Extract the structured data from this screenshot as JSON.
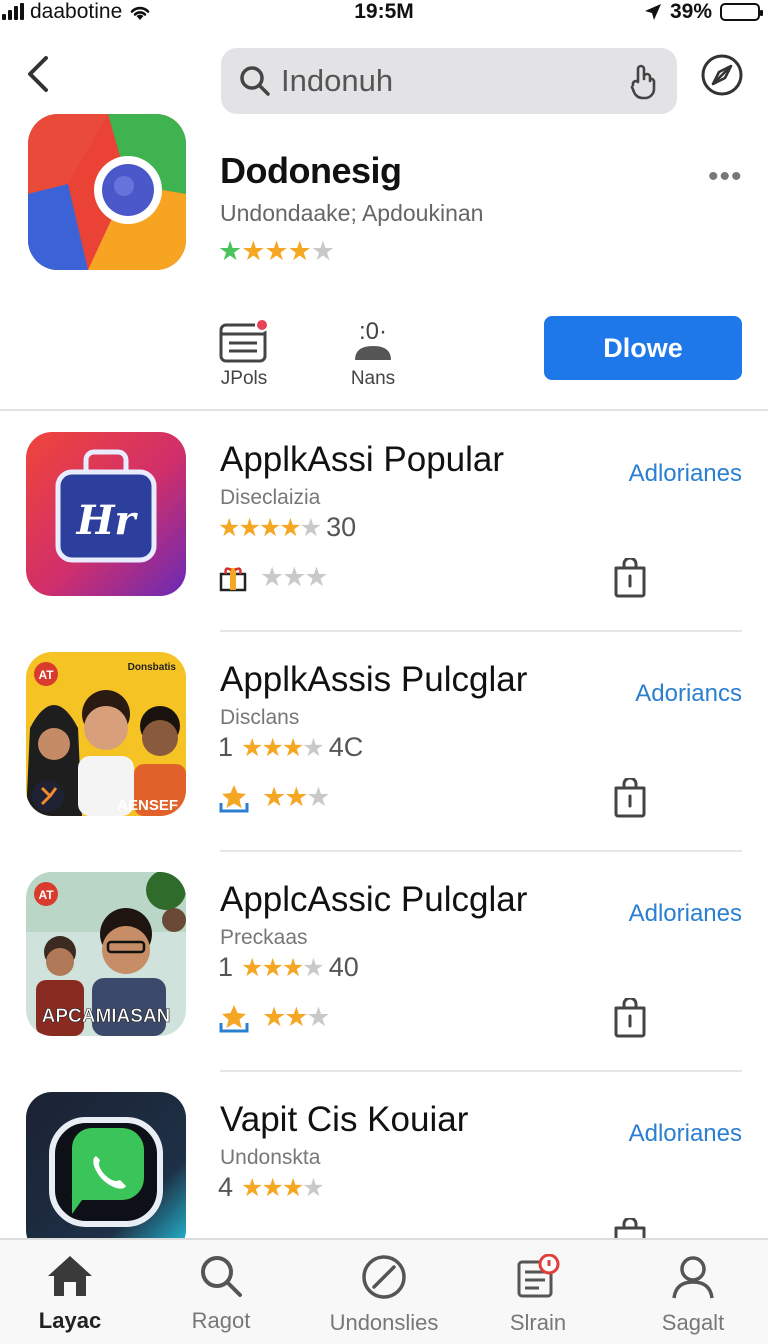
{
  "status_bar": {
    "carrier": "daabotine",
    "time": "19:5M",
    "battery": "39%"
  },
  "search": {
    "value": "Indonuh"
  },
  "hero": {
    "title": "Dodonesig",
    "subtitle": "Undondaake; Apdoukinan",
    "stars": "★★★★★",
    "more": "•••",
    "actions": [
      {
        "label": "JPols"
      },
      {
        "label": "Nans",
        "glyph": ":0·"
      }
    ],
    "get_label": "Dlowe"
  },
  "apps": [
    {
      "title": "ApplkAssi Popular",
      "subtitle": "Diseclaizia",
      "rating_prefix": "",
      "rating_suffix": "30",
      "action": "Adlorianes"
    },
    {
      "title": "ApplkAssis Pulcglar",
      "subtitle": "Disclans",
      "rating_prefix": "1",
      "rating_suffix": "4C",
      "action": "Adoriancs",
      "icon_text": "AENSEF",
      "icon_badge": "AT",
      "icon_corner": "Donsbatis"
    },
    {
      "title": "ApplcAssic Pulcglar",
      "subtitle": "Preckaas",
      "rating_prefix": "1",
      "rating_suffix": "40",
      "action": "Adlorianes",
      "icon_text": "APCAMIASAN",
      "icon_badge": "AT"
    },
    {
      "title": "Vapit Cis Kouiar",
      "subtitle": "Undonsktа",
      "rating_prefix": "4",
      "rating_suffix": "",
      "action": "Adlorianes"
    }
  ],
  "tabs": [
    {
      "label": "Layac",
      "icon": "home-icon"
    },
    {
      "label": "Ragot",
      "icon": "search-icon"
    },
    {
      "label": "Undonslies",
      "icon": "compass-icon"
    },
    {
      "label": "Slrain",
      "icon": "list-icon"
    },
    {
      "label": "Sagalt",
      "icon": "person-icon"
    }
  ],
  "colors": {
    "accent": "#1f78ea",
    "link": "#2a7fd0",
    "star": "#f5a623"
  }
}
